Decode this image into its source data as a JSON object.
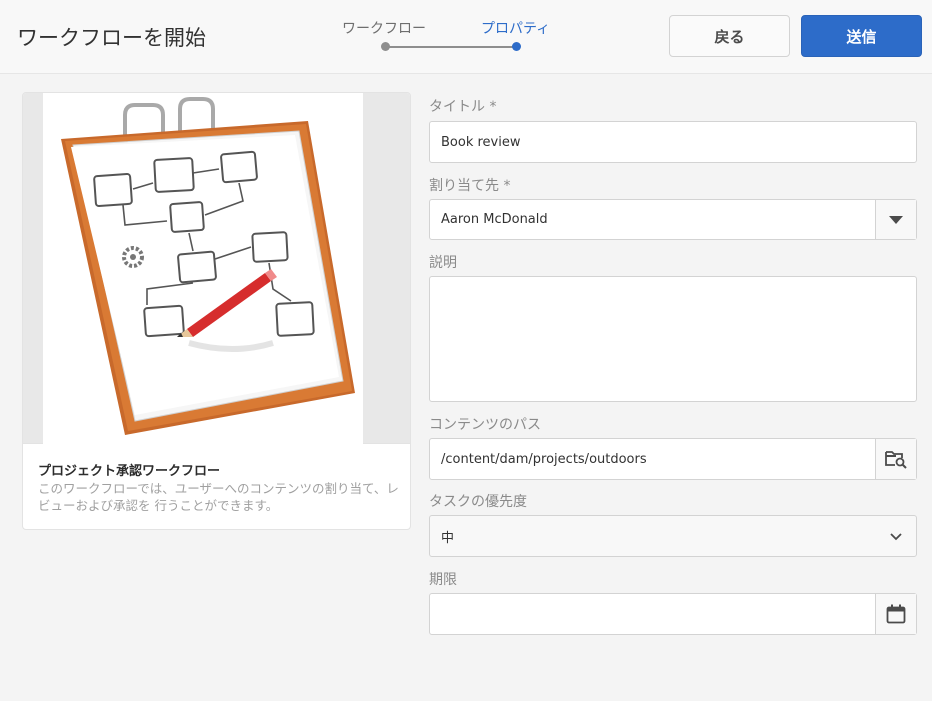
{
  "header": {
    "title": "ワークフローを開始",
    "steps": [
      "ワークフロー",
      "プロパティ"
    ],
    "back_label": "戻る",
    "submit_label": "送信"
  },
  "card": {
    "title": "プロジェクト承認ワークフロー",
    "description": "このワークフローでは、ユーザーへのコンテンツの割り当て、レビューおよび承認を 行うことができます。"
  },
  "form": {
    "title_label": "タイトル *",
    "title_value": "Book review",
    "assignee_label": "割り当て先 *",
    "assignee_value": "Aaron McDonald",
    "description_label": "説明",
    "description_value": "",
    "path_label": "コンテンツのパス",
    "path_value": "/content/dam/projects/outdoors",
    "priority_label": "タスクの優先度",
    "priority_value": "中",
    "due_label": "期限",
    "due_value": ""
  },
  "colors": {
    "accent": "#2d6cc9",
    "background": "#f4f4f4"
  },
  "icons": {
    "assignee_dropdown": "triangle-down-icon",
    "path_browse": "folder-search-icon",
    "priority_dropdown": "chevron-down-icon",
    "due_picker": "calendar-icon"
  }
}
